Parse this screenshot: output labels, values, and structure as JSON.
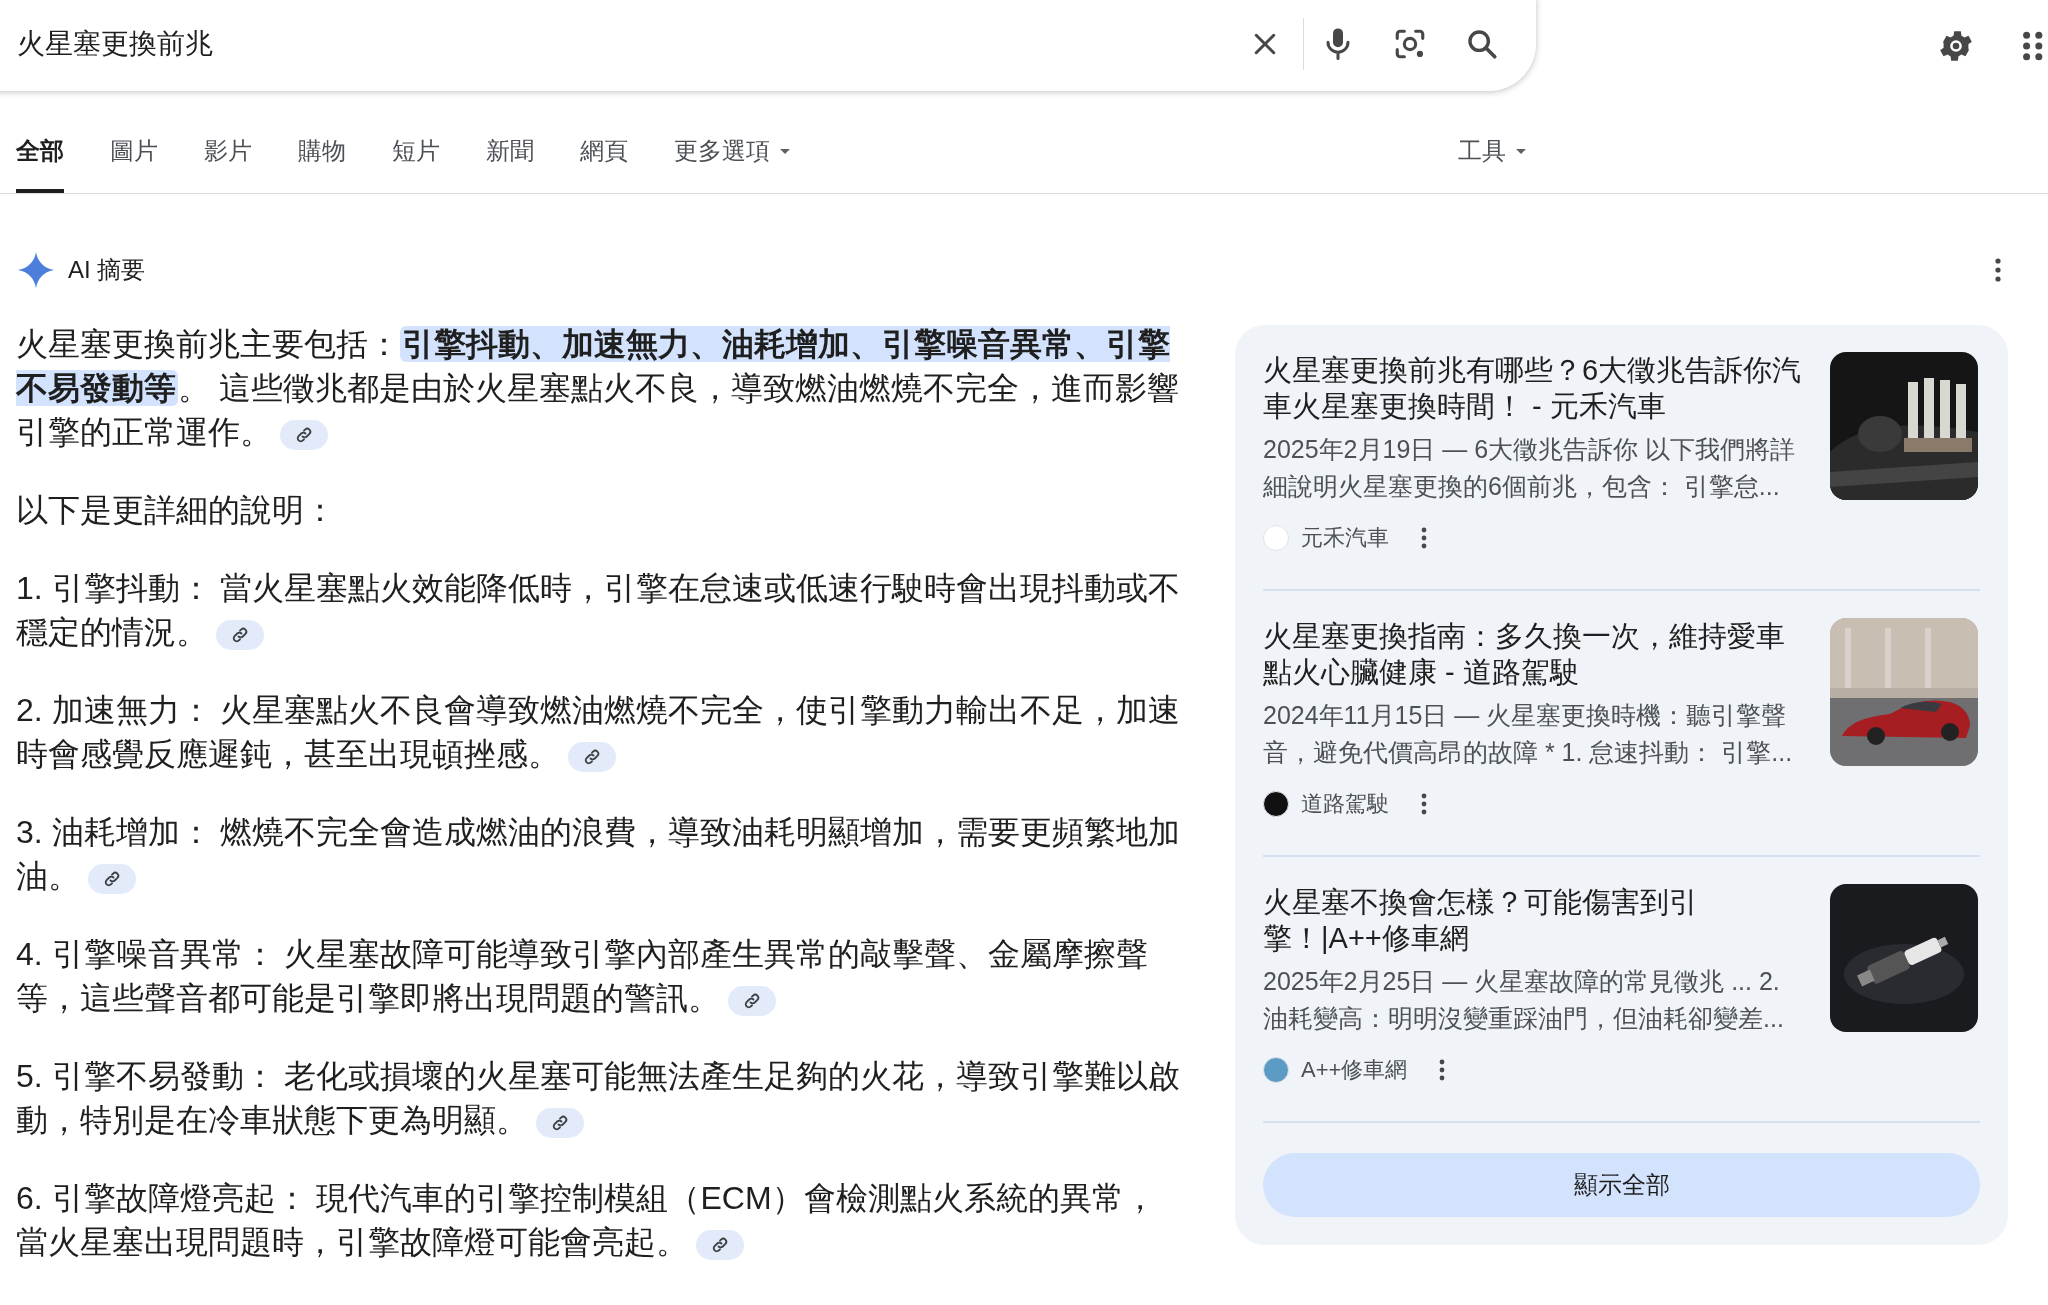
{
  "search": {
    "value": "火星塞更換前兆"
  },
  "tabs": [
    {
      "label": "全部",
      "selected": true,
      "has_menu": false
    },
    {
      "label": "圖片",
      "selected": false,
      "has_menu": false
    },
    {
      "label": "影片",
      "selected": false,
      "has_menu": false
    },
    {
      "label": "購物",
      "selected": false,
      "has_menu": false
    },
    {
      "label": "短片",
      "selected": false,
      "has_menu": false
    },
    {
      "label": "新聞",
      "selected": false,
      "has_menu": false
    },
    {
      "label": "網頁",
      "selected": false,
      "has_menu": false
    },
    {
      "label": "更多選項",
      "selected": false,
      "has_menu": true
    }
  ],
  "tools": {
    "label": "工具"
  },
  "ai_overview": {
    "title": "AI 摘要",
    "paragraphs": [
      {
        "text": "火星塞更換前兆主要包括：**引擎抖動、加速無力、油耗增加、引擎噪音異常、引擎不易發動等**。 這些徵兆都是由於火星塞點火不良，導致燃油燃燒不完全，進而影響引擎的正常運作。",
        "source_link": true
      },
      {
        "text": "以下是更詳細的說明：",
        "source_link": false
      },
      {
        "text": "1. 引擎抖動： 當火星塞點火效能降低時，引擎在怠速或低速行駛時會出現抖動或不穩定的情況。",
        "source_link": true
      },
      {
        "text": "2. 加速無力： 火星塞點火不良會導致燃油燃燒不完全，使引擎動力輸出不足，加速時會感覺反應遲鈍，甚至出現頓挫感。",
        "source_link": true
      },
      {
        "text": "3. 油耗增加： 燃燒不完全會造成燃油的浪費，導致油耗明顯增加，需要更頻繁地加油。",
        "source_link": true
      },
      {
        "text": "4. 引擎噪音異常： 火星塞故障可能導致引擎內部產生異常的敲擊聲、金屬摩擦聲等，這些聲音都可能是引擎即將出現問題的警訊。",
        "source_link": true
      },
      {
        "text": "5. 引擎不易發動： 老化或損壞的火星塞可能無法產生足夠的火花，導致引擎難以啟動，特別是在冷車狀態下更為明顯。",
        "source_link": true
      },
      {
        "text": "6. 引擎故障燈亮起： 現代汽車的引擎控制模組（ECM）會檢測點火系統的異常，當火星塞出現問題時，引擎故障燈可能會亮起。",
        "source_link": true
      }
    ]
  },
  "sources": {
    "cards": [
      {
        "title": "火星塞更換前兆有哪些？6大徵兆告訴你汽車火星塞更換時間！ - 元禾汽車",
        "snippet": "2025年2月19日 — 6大徵兆告訴你 以下我們將詳細說明火星塞更換的6個前兆，包含： 引擎怠...",
        "site": "元禾汽車",
        "color": "#ffffff",
        "kind": "picture"
      },
      {
        "title": "火星塞更換指南：多久換一次，維持愛車點火心臟健康 - 道路駕駛",
        "snippet": "2024年11月15日 — 火星塞更換時機：聽引擎聲音，避免代價高昂的故障 * 1. 怠速抖動： 引擎...",
        "site": "道路駕駛",
        "color": "#111111",
        "kind": "picture"
      },
      {
        "title": "火星塞不換會怎樣？可能傷害到引擎！|A++修車網",
        "snippet": "2025年2月25日 — 火星塞故障的常見徵兆 ... 2. 油耗變高：明明沒變重踩油門，但油耗卻變差...",
        "site": "A++修車網",
        "color": "#5b9bc4",
        "kind": "picture"
      }
    ],
    "show_all": "顯示全部"
  }
}
